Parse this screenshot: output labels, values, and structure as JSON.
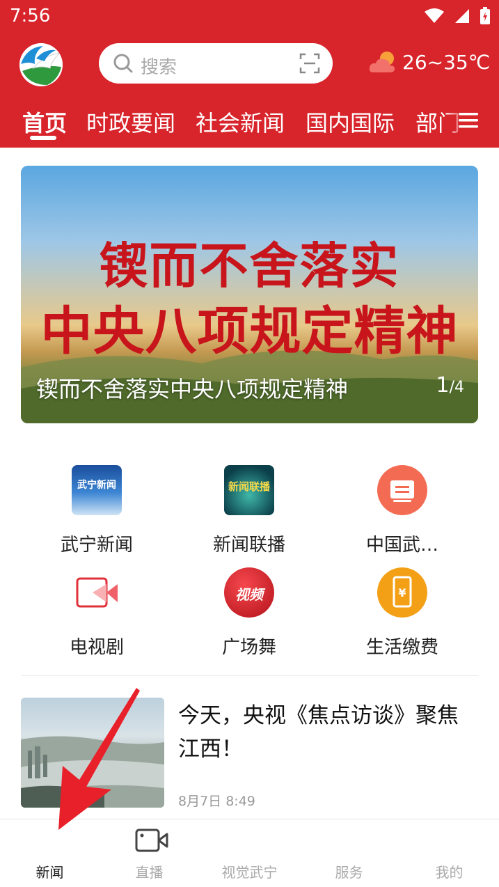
{
  "status_bar": {
    "time": "7:56"
  },
  "header": {
    "search_placeholder": "搜索",
    "weather": "26~35℃"
  },
  "tabs": [
    {
      "label": "首页",
      "active": true
    },
    {
      "label": "时政要闻"
    },
    {
      "label": "社会新闻"
    },
    {
      "label": "国内国际"
    },
    {
      "label": "部门"
    }
  ],
  "banner": {
    "headline_line1": "锲而不舍落实",
    "headline_line2": "中央八项规定精神",
    "caption": "锲而不舍落实中央八项规定精神",
    "counter_current": "1",
    "counter_total": "/4"
  },
  "grid": [
    {
      "label": "武宁新闻",
      "icon": "wuning-news-icon",
      "icon_text": "武宁新闻"
    },
    {
      "label": "新闻联播",
      "icon": "news-broadcast-icon",
      "icon_text": "新闻联播"
    },
    {
      "label": "中国武…",
      "icon": "document-icon"
    },
    {
      "label": "电视剧",
      "icon": "tv-series-icon"
    },
    {
      "label": "广场舞",
      "icon": "video-badge-icon",
      "icon_text": "视频"
    },
    {
      "label": "生活缴费",
      "icon": "phone-payment-icon"
    }
  ],
  "news": [
    {
      "title": "今天，央视《焦点访谈》聚焦江西！",
      "time": "8月7日 8:49"
    }
  ],
  "bottom_nav": [
    {
      "label": "新闻",
      "active": true
    },
    {
      "label": "直播",
      "icon": "video-camera-icon"
    },
    {
      "label": "视觉武宁"
    },
    {
      "label": "服务"
    },
    {
      "label": "我的"
    }
  ],
  "colors": {
    "brand_red": "#d8242b",
    "arrow_red": "#e8202a",
    "orange": "#f36b52",
    "amber": "#f4a017"
  }
}
